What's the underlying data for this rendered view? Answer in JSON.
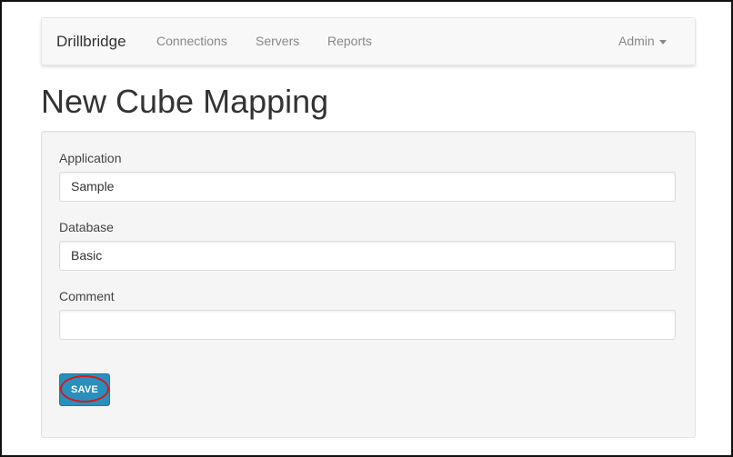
{
  "navbar": {
    "brand": "Drillbridge",
    "links": [
      "Connections",
      "Servers",
      "Reports"
    ],
    "user_menu": "Admin"
  },
  "page": {
    "title": "New Cube Mapping"
  },
  "form": {
    "application": {
      "label": "Application",
      "value": "Sample"
    },
    "database": {
      "label": "Database",
      "value": "Basic"
    },
    "comment": {
      "label": "Comment",
      "value": ""
    },
    "save_label": "SAVE"
  },
  "colors": {
    "save_button": "#2a8fbd",
    "annotation": "#d41a1a"
  }
}
